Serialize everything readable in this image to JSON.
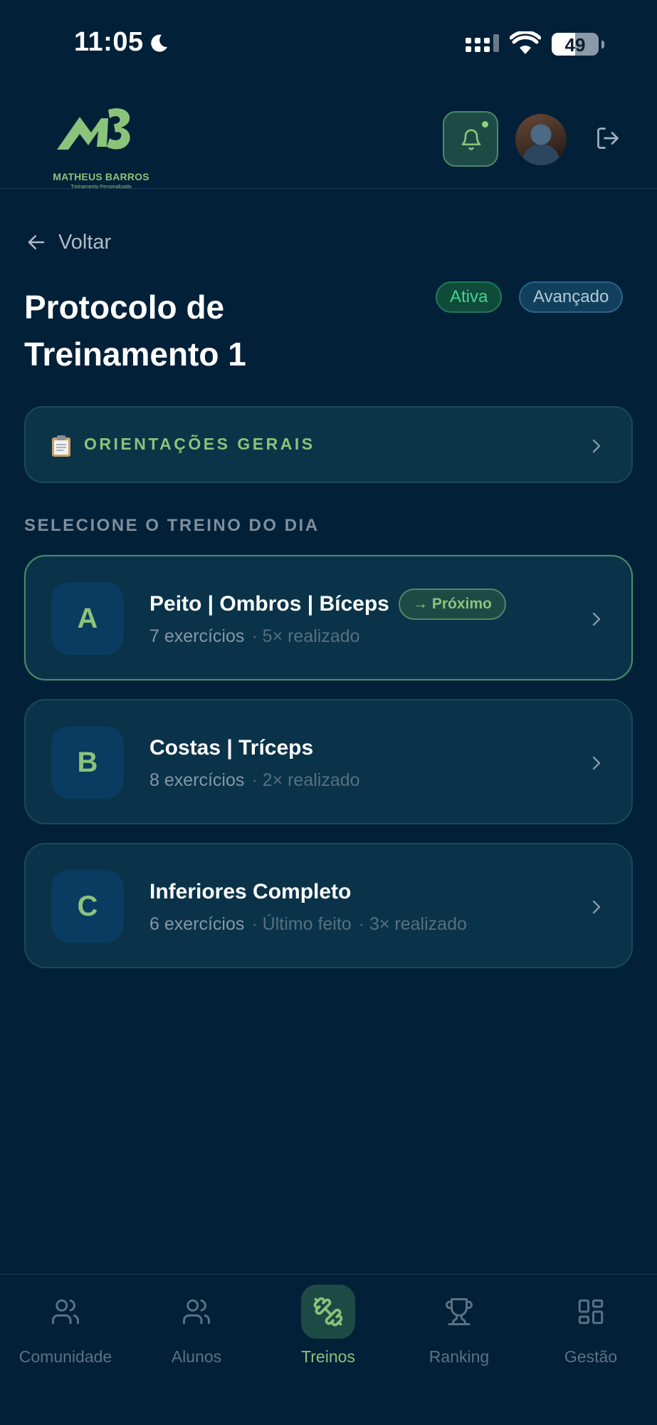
{
  "status_bar": {
    "time": "11:05",
    "battery": "49"
  },
  "header": {
    "logo_title": "MATHEUS BARROS",
    "logo_subtitle": "Treinamento Personalizado"
  },
  "back_label": "Voltar",
  "page_title": "Protocolo de Treinamento 1",
  "badges": {
    "status": "Ativa",
    "level": "Avançado"
  },
  "orientations": {
    "icon": "clipboard-icon",
    "label": "ORIENTAÇÕES GERAIS"
  },
  "section_label": "SELECIONE O TREINO DO DIA",
  "workouts": [
    {
      "letter": "A",
      "name": "Peito | Ombros | Bíceps",
      "tag": "→ Próximo",
      "exercises": "7 exercícios",
      "extra1": "· 5× realizado",
      "extra2": ""
    },
    {
      "letter": "B",
      "name": "Costas | Tríceps",
      "tag": "",
      "exercises": "8 exercícios",
      "extra1": "· 2× realizado",
      "extra2": ""
    },
    {
      "letter": "C",
      "name": "Inferiores Completo",
      "tag": "",
      "exercises": "6 exercícios",
      "extra1": "· Último feito",
      "extra2": "· 3× realizado"
    }
  ],
  "bottom_nav": [
    {
      "label": "Comunidade",
      "icon": "users-icon",
      "active": false
    },
    {
      "label": "Alunos",
      "icon": "users-icon",
      "active": false
    },
    {
      "label": "Treinos",
      "icon": "dumbbell-icon",
      "active": true
    },
    {
      "label": "Ranking",
      "icon": "trophy-icon",
      "active": false
    },
    {
      "label": "Gestão",
      "icon": "grid-icon",
      "active": false
    }
  ],
  "colors": {
    "background": "#032039",
    "accent_green": "#8bc37b",
    "active_green": "#3dd68c"
  }
}
